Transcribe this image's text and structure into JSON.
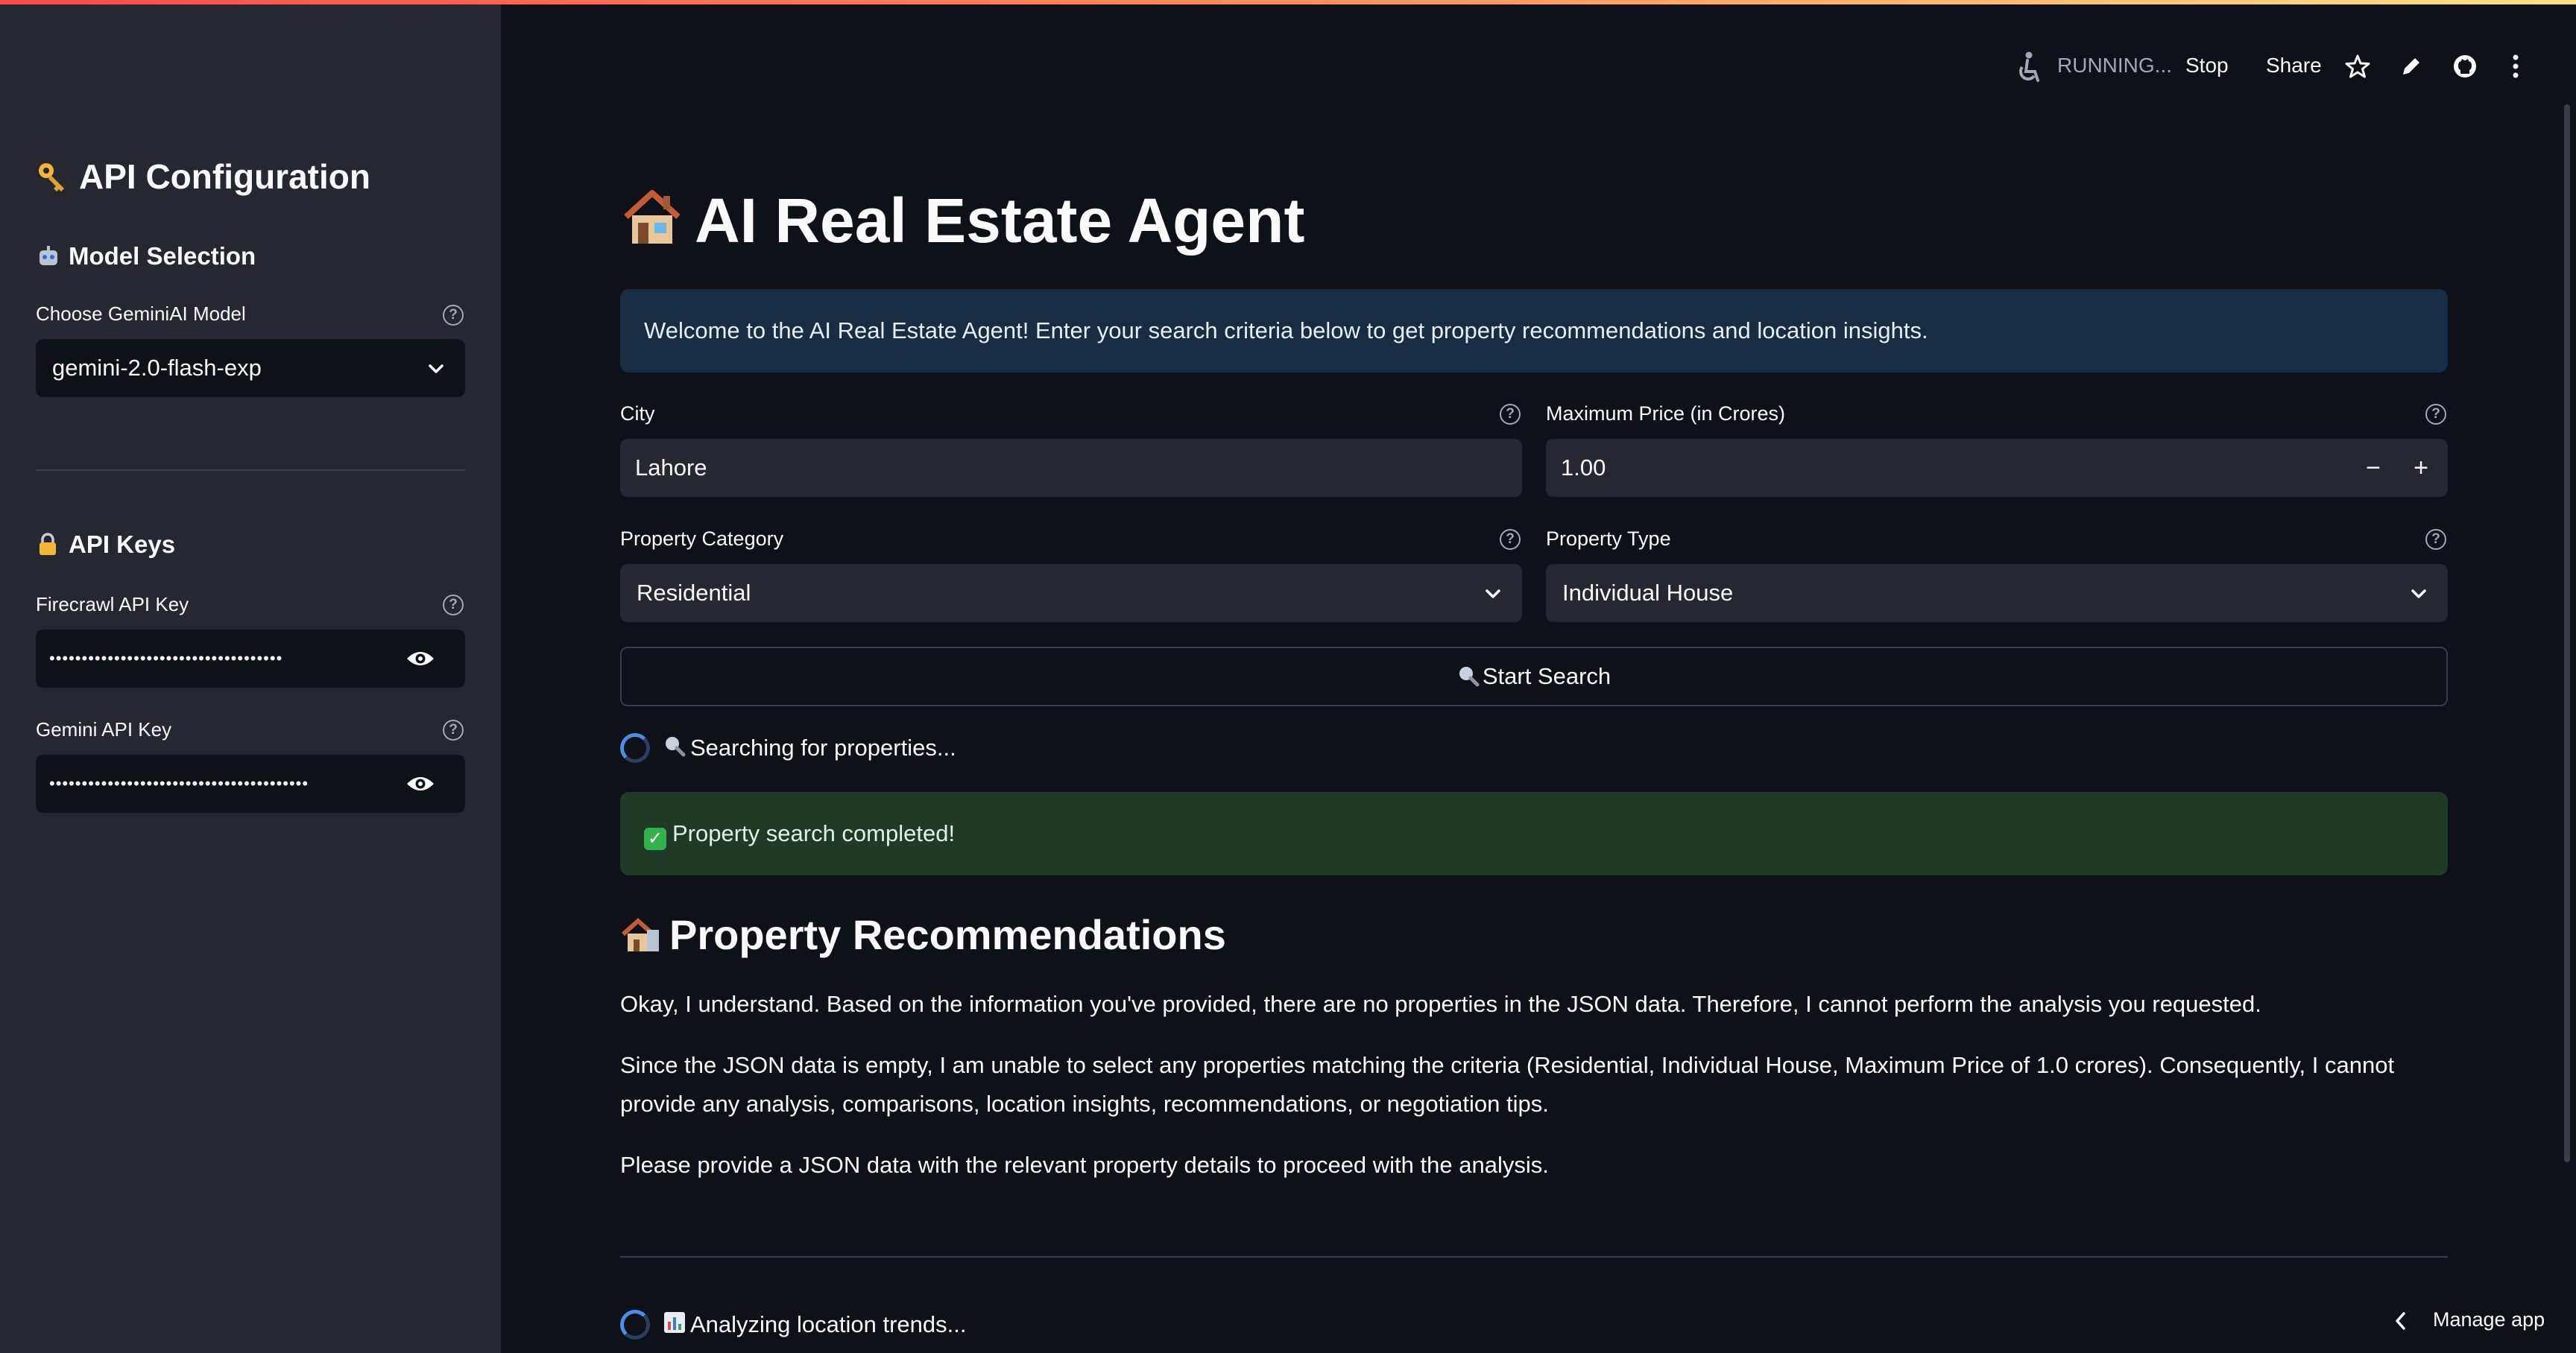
{
  "toolbar": {
    "running": "RUNNING...",
    "stop": "Stop",
    "share": "Share"
  },
  "sidebar": {
    "title": "API Configuration",
    "model_section": "Model Selection",
    "model_label": "Choose GeminiAI Model",
    "model_value": "gemini-2.0-flash-exp",
    "keys_section": "API Keys",
    "firecrawl_label": "Firecrawl API Key",
    "firecrawl_value": "••••••••••••••••••••••••••••••••••••",
    "gemini_label": "Gemini API Key",
    "gemini_value": "••••••••••••••••••••••••••••••••••••••••"
  },
  "main": {
    "title": "AI Real Estate Agent",
    "welcome": "Welcome to the AI Real Estate Agent! Enter your search criteria below to get property recommendations and location insights.",
    "city_label": "City",
    "city_value": "Lahore",
    "price_label": "Maximum Price (in Crores)",
    "price_value": "1.00",
    "category_label": "Property Category",
    "category_value": "Residential",
    "type_label": "Property Type",
    "type_value": "Individual House",
    "search_button": "Start Search",
    "searching_text": "Searching for properties...",
    "success_text": "Property search completed!",
    "recommendations_title": "Property Recommendations",
    "para1": "Okay, I understand. Based on the information you've provided, there are no properties in the JSON data. Therefore, I cannot perform the analysis you requested.",
    "para2": "Since the JSON data is empty, I am unable to select any properties matching the criteria (Residential, Individual House, Maximum Price of 1.0 crores). Consequently, I cannot provide any analysis, comparisons, location insights, recommendations, or negotiation tips.",
    "para3": "Please provide a JSON data with the relevant property details to proceed with the analysis.",
    "analyzing_text": "Analyzing location trends...",
    "manage_app": "Manage app"
  }
}
